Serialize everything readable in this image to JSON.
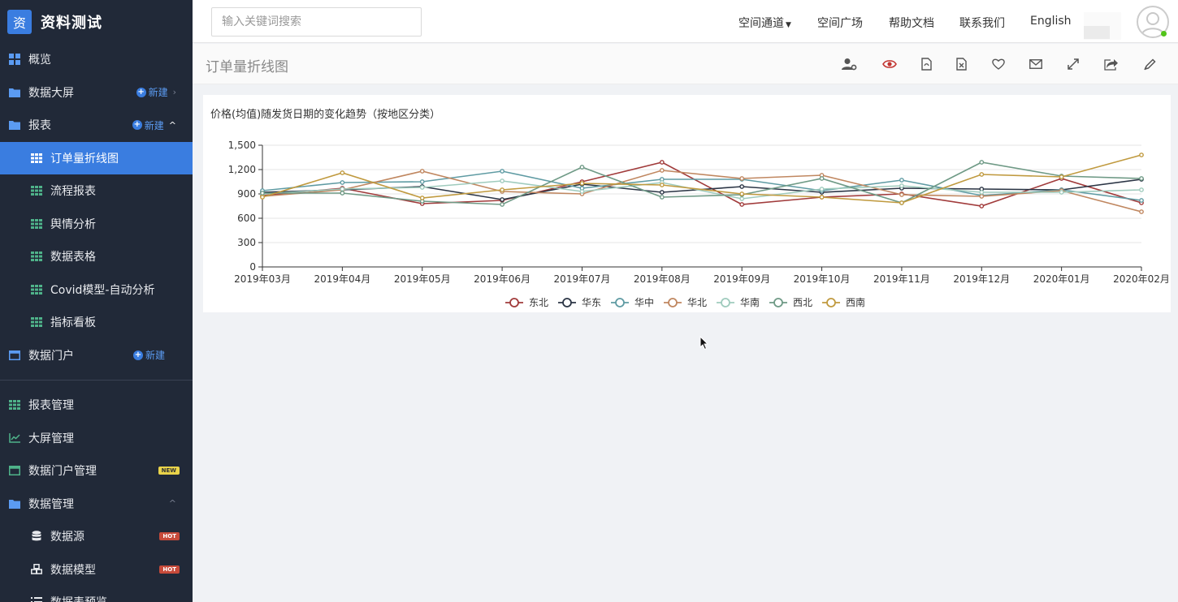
{
  "app": {
    "logo_char": "资",
    "title": "资料测试"
  },
  "sidebar": {
    "items": [
      {
        "label": "概览",
        "icon": "grid-icon"
      },
      {
        "label": "数据大屏",
        "icon": "folder-icon",
        "new_label": "新建"
      },
      {
        "label": "报表",
        "icon": "folder-icon",
        "new_label": "新建"
      },
      {
        "label": "订单量折线图",
        "icon": "table-icon"
      },
      {
        "label": "流程报表",
        "icon": "table-icon"
      },
      {
        "label": "舆情分析",
        "icon": "table-icon"
      },
      {
        "label": "数据表格",
        "icon": "table-icon"
      },
      {
        "label": "Covid模型-自动分析",
        "icon": "table-icon"
      },
      {
        "label": "指标看板",
        "icon": "table-icon"
      },
      {
        "label": "数据门户",
        "icon": "window-icon",
        "new_label": "新建"
      },
      {
        "label": "报表管理",
        "icon": "table-icon"
      },
      {
        "label": "大屏管理",
        "icon": "line-chart-icon"
      },
      {
        "label": "数据门户管理",
        "icon": "window-icon",
        "badge": "NEW"
      },
      {
        "label": "数据管理",
        "icon": "folder-icon"
      },
      {
        "label": "数据源",
        "icon": "database-icon",
        "badge": "HOT"
      },
      {
        "label": "数据模型",
        "icon": "cubes-icon",
        "badge": "HOT"
      },
      {
        "label": "数据表预览",
        "icon": "list-icon"
      }
    ]
  },
  "topbar": {
    "search_placeholder": "输入关键词搜索",
    "links": [
      "空间通道",
      "空间广场",
      "帮助文档",
      "联系我们",
      "English"
    ]
  },
  "page": {
    "title": "订单量折线图",
    "toolbar_icons": [
      "user-settings-icon",
      "eye-icon",
      "export-pdf-icon",
      "export-excel-icon",
      "heart-icon",
      "mail-icon",
      "fullscreen-icon",
      "share-icon",
      "edit-icon"
    ],
    "colors": {
      "accent": "#3a7de0",
      "sidebar_bg": "#212938",
      "eye_icon": "#c23531"
    }
  },
  "chart_data": {
    "type": "line",
    "title": "价格(均值)随发货日期的变化趋势（按地区分类）",
    "x": [
      "2019年03月",
      "2019年04月",
      "2019年05月",
      "2019年06月",
      "2019年07月",
      "2019年08月",
      "2019年09月",
      "2019年10月",
      "2019年11月",
      "2019年12月",
      "2020年01月",
      "2020年02月"
    ],
    "ylim": [
      0,
      1500
    ],
    "yticks": [
      "0",
      "300",
      "600",
      "900",
      "1,200",
      "1,500"
    ],
    "legend_position": "bottom",
    "grid": true,
    "series": [
      {
        "name": "东北",
        "color": "#a13b3b",
        "values": [
          880,
          970,
          780,
          820,
          1050,
          1290,
          770,
          860,
          900,
          750,
          1090,
          790
        ]
      },
      {
        "name": "华东",
        "color": "#2b3545",
        "values": [
          920,
          950,
          990,
          830,
          1020,
          920,
          990,
          920,
          970,
          960,
          950,
          1080
        ]
      },
      {
        "name": "华中",
        "color": "#5f9ba3",
        "values": [
          940,
          1040,
          1050,
          1180,
          970,
          1080,
          1080,
          940,
          1070,
          880,
          950,
          820
        ]
      },
      {
        "name": "华北",
        "color": "#c08760",
        "values": [
          870,
          950,
          1180,
          930,
          900,
          1190,
          1090,
          1130,
          890,
          870,
          940,
          680
        ]
      },
      {
        "name": "华南",
        "color": "#9fcbbd",
        "values": [
          900,
          960,
          980,
          1060,
          930,
          1040,
          840,
          960,
          1000,
          920,
          920,
          950
        ]
      },
      {
        "name": "西北",
        "color": "#6f9a86",
        "values": [
          910,
          910,
          810,
          770,
          1230,
          860,
          890,
          1090,
          790,
          1290,
          1120,
          1090
        ]
      },
      {
        "name": "西南",
        "color": "#c09a3f",
        "values": [
          860,
          1160,
          850,
          950,
          1030,
          1010,
          900,
          860,
          790,
          1140,
          1110,
          1380
        ]
      }
    ]
  }
}
